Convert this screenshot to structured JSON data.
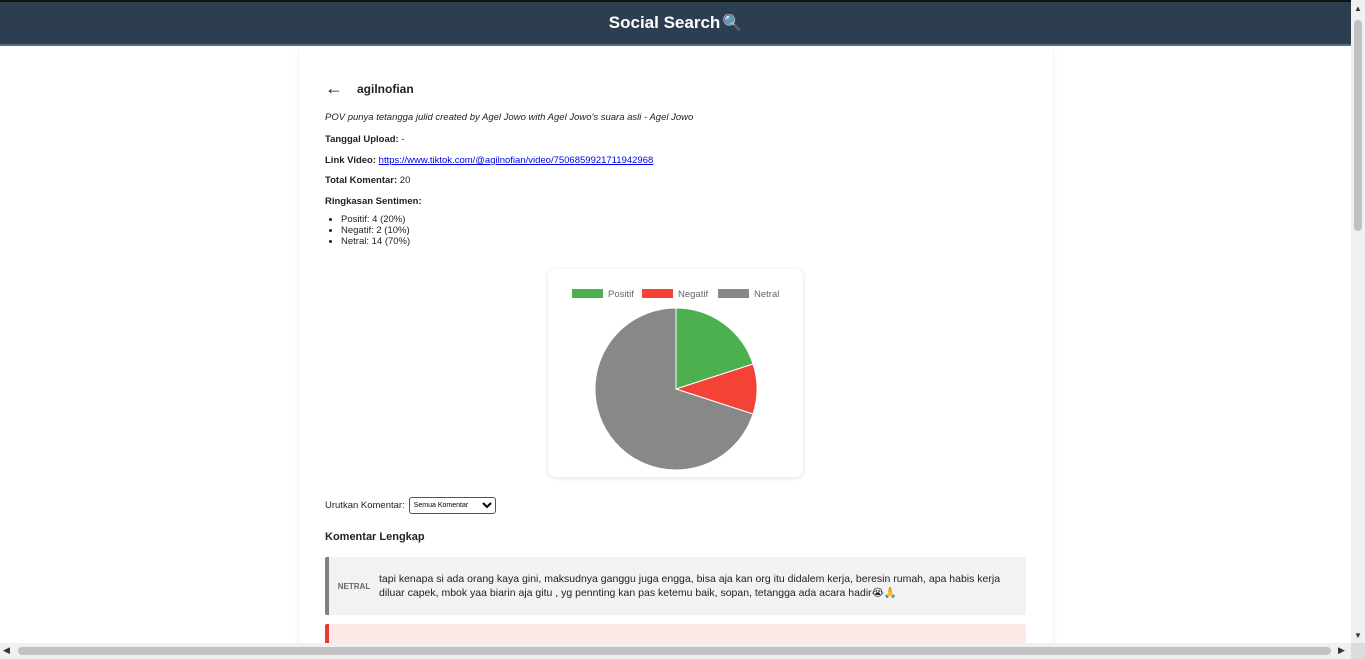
{
  "header": {
    "title": "Social Search",
    "emoji": "🔍"
  },
  "video": {
    "back_icon": "←",
    "username": "agilnofian",
    "description": "POV punya tetangga julid created by Agel Jowo with Agel Jowo's suara asli - Agel Jowo",
    "upload_label": "Tanggal Upload:",
    "upload_value": " -",
    "link_label": "Link Video:",
    "link_value": "https://www.tiktok.com/@agilnofian/video/7506859921711942968",
    "total_label": "Total Komentar:",
    "total_value": " 20",
    "summary_label": "Ringkasan Sentimen:",
    "summary_items": [
      "Positif: 4 (20%)",
      "Negatif: 2 (10%)",
      "Netral: 14 (70%)"
    ]
  },
  "chart_data": {
    "type": "pie",
    "categories": [
      "Positif",
      "Negatif",
      "Netral"
    ],
    "values": [
      4,
      2,
      14
    ],
    "colors": [
      "#4caf50",
      "#f44336",
      "#888888"
    ],
    "title": "",
    "legend": "top"
  },
  "sort": {
    "label": "Urutkan Komentar:",
    "selected": "Semua Komentar"
  },
  "comments_section": {
    "title": "Komentar Lengkap",
    "items": [
      {
        "label": "NETRAL",
        "text": "tapi kenapa si ada orang kaya gini, maksudnya ganggu juga engga, bisa aja kan org itu didalem kerja, beresin rumah, apa habis kerja diluar capek, mbok yaa biarin aja gitu , yg pennting kan pas ketemu baik, sopan, tetangga ada acara hadir😭🙏"
      },
      {
        "label": "",
        "text": ""
      }
    ]
  },
  "scrollbars": {
    "up": "▲",
    "down": "▼",
    "left": "◀",
    "right": "▶"
  }
}
